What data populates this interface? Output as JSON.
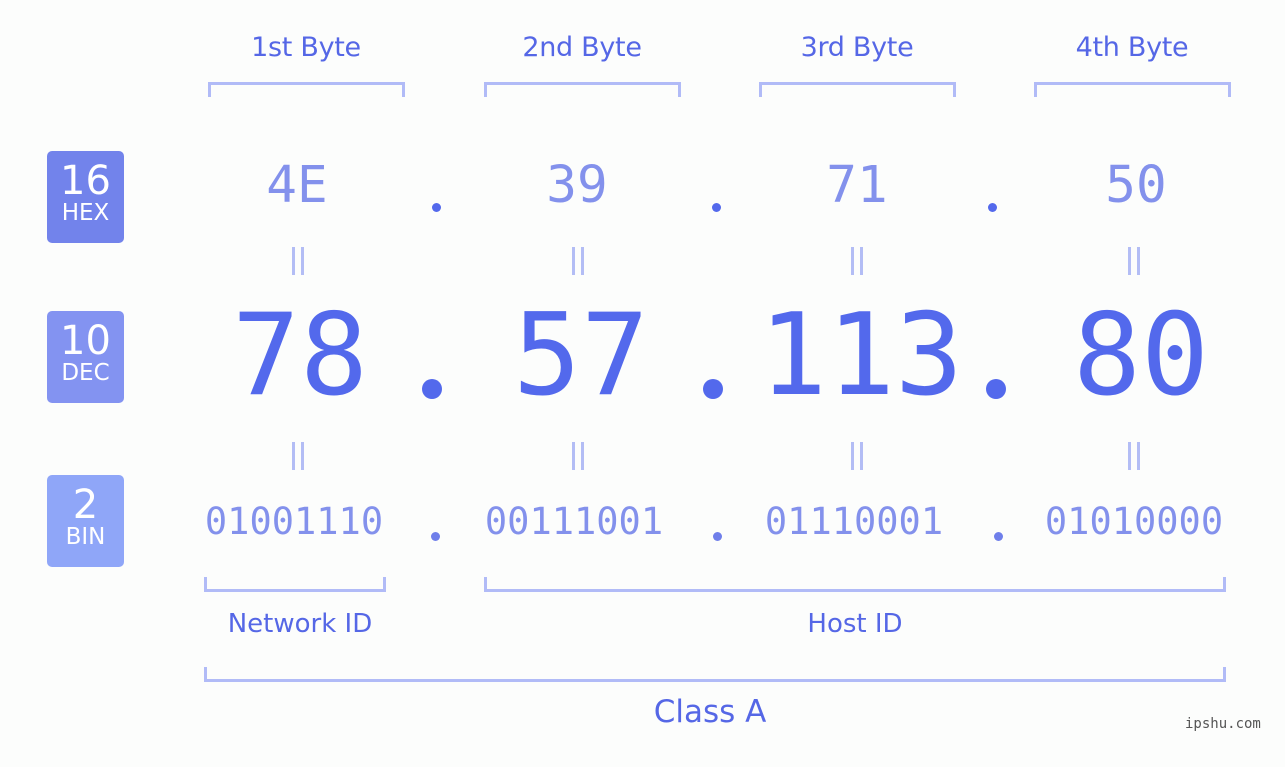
{
  "bytes": [
    {
      "title": "1st Byte",
      "hex": "4E",
      "dec": "78",
      "bin": "01001110"
    },
    {
      "title": "2nd Byte",
      "hex": "39",
      "dec": "57",
      "bin": "00111001"
    },
    {
      "title": "3rd Byte",
      "hex": "71",
      "dec": "113",
      "bin": "01110001"
    },
    {
      "title": "4th Byte",
      "hex": "50",
      "dec": "80",
      "bin": "01010000"
    }
  ],
  "badges": {
    "hex": {
      "num": "16",
      "label": "HEX",
      "color": "#7283eb"
    },
    "dec": {
      "num": "10",
      "label": "DEC",
      "color": "#8393f1"
    },
    "bin": {
      "num": "2",
      "label": "BIN",
      "color": "#8fa6f8"
    }
  },
  "parts": {
    "network": "Network ID",
    "host": "Host ID"
  },
  "ip_class": "Class A",
  "watermark": "ipshu.com",
  "colors": {
    "accent": "#5369ec",
    "bracket": "#b1bbf7",
    "light_text": "#8391ec"
  }
}
